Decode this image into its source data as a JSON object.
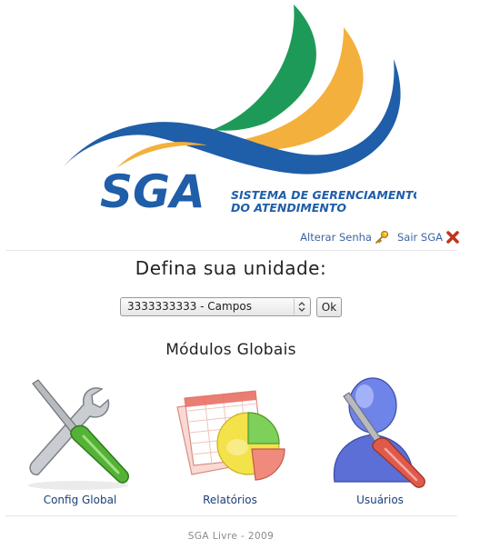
{
  "brand": {
    "logo_text": "SGA",
    "tagline_line1": "SISTEMA DE GERENCIAMENTO",
    "tagline_line2": "DO ATENDIMENTO",
    "colors": {
      "blue": "#1f5ea8",
      "green": "#1e9a58",
      "yellow": "#f4b03d"
    }
  },
  "top_links": {
    "change_password": "Alterar Senha",
    "change_password_icon": "key-icon",
    "logout": "Sair SGA",
    "logout_icon": "close-x-icon"
  },
  "unit": {
    "heading": "Defina sua unidade:",
    "selected": "3333333333 - Campos",
    "ok_label": "Ok"
  },
  "modules": {
    "heading": "Módulos Globais",
    "items": [
      {
        "label": "Config Global",
        "icon": "tools-icon"
      },
      {
        "label": "Relatórios",
        "icon": "reports-icon"
      },
      {
        "label": "Usuários",
        "icon": "users-icon"
      }
    ]
  },
  "footer": {
    "text": "SGA Livre - 2009"
  }
}
